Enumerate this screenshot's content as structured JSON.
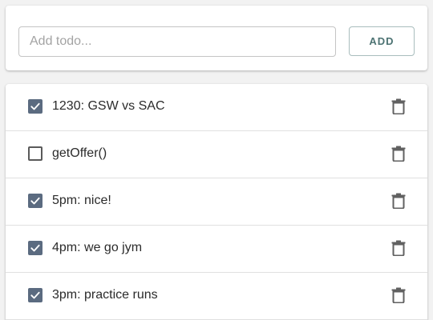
{
  "add_form": {
    "input_placeholder": "Add todo...",
    "input_value": "",
    "add_button_label": "ADD"
  },
  "todos": [
    {
      "text": "1230: GSW vs SAC",
      "completed": true
    },
    {
      "text": "getOffer()",
      "completed": false
    },
    {
      "text": "5pm: nice!",
      "completed": true
    },
    {
      "text": "4pm: we go jym",
      "completed": true
    },
    {
      "text": "3pm: practice runs",
      "completed": true
    }
  ],
  "icons": {
    "checkbox": "checkbox-icon",
    "delete": "trash-icon"
  },
  "colors": {
    "background": "#f2f2f2",
    "checkbox_checked": "#5b6b80",
    "add_button_text": "#4d7373",
    "icon_gray": "#616161"
  }
}
